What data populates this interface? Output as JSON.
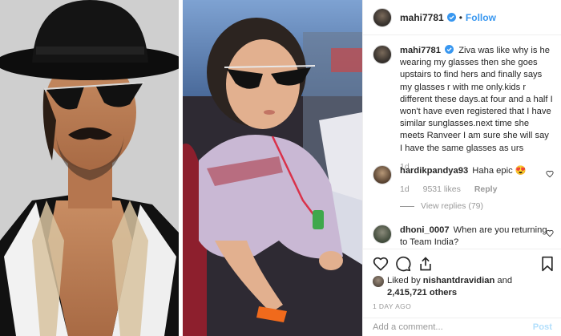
{
  "post": {
    "username": "mahi7781",
    "follow_label": "Follow",
    "separator": "•"
  },
  "caption": {
    "username": "mahi7781",
    "text": "Ziva was like why is he wearing my glasses then she goes upstairs to find hers and finally says my glasses r with me only.kids r different these days.at four and a half I won't have even registered that I have similar sunglasses.next time she meets Ranveer I am sure she will say I have the same glasses as urs",
    "time": "1d"
  },
  "comments": [
    {
      "username": "hardikpandya93",
      "text": "Haha epic 😍",
      "time": "1d",
      "likes": "9531 likes",
      "reply_label": "Reply",
      "view_replies": "View replies (79)"
    },
    {
      "username": "dhoni_0007",
      "text": "When are you returning to Team India?"
    }
  ],
  "likes": {
    "prefix": "Liked by",
    "user": "nishantdravidian",
    "and": "and",
    "count": "2,415,721 others"
  },
  "date": "1 DAY AGO",
  "composer": {
    "placeholder": "Add a comment...",
    "post_label": "Post"
  },
  "colors": {
    "link_blue": "#3897f0",
    "post_disabled": "#b2dffc",
    "muted": "#999999"
  }
}
